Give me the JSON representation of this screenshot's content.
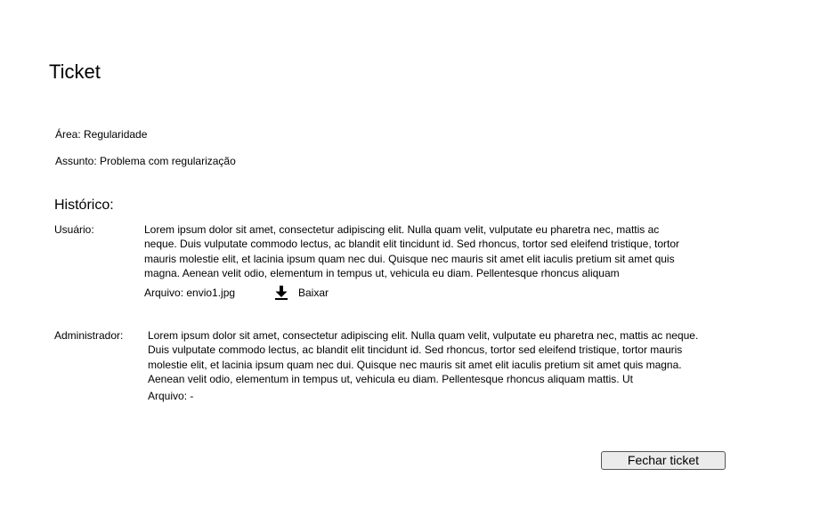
{
  "page": {
    "title": "Ticket"
  },
  "ticket": {
    "area": "Área: Regularidade",
    "subject": "Assunto: Problema com regularização"
  },
  "history": {
    "title": "Histórico:",
    "entries": [
      {
        "author": "Usuário:",
        "message": "Lorem ipsum dolor sit amet, consectetur adipiscing elit. Nulla quam velit, vulputate eu pharetra nec, mattis ac neque. Duis vulputate commodo lectus, ac blandit elit tincidunt id. Sed rhoncus, tortor sed eleifend tristique, tortor mauris molestie elit, et lacinia ipsum quam nec dui. Quisque nec mauris sit amet elit iaculis pretium sit amet quis magna. Aenean velit odio, elementum in tempus ut, vehicula eu diam. Pellentesque rhoncus aliquam",
        "attachment": "Arquivo: envio1.jpg",
        "download_label": "Baixar",
        "download_icon": "download-icon"
      },
      {
        "author": "Administrador:",
        "message": "Lorem ipsum dolor sit amet, consectetur adipiscing elit. Nulla quam velit, vulputate eu pharetra nec, mattis ac neque. Duis vulputate commodo lectus, ac blandit elit tincidunt id. Sed rhoncus, tortor sed eleifend tristique, tortor mauris molestie elit, et lacinia ipsum quam nec dui. Quisque nec mauris sit amet elit iaculis pretium sit amet quis magna. Aenean velit odio, elementum in tempus ut, vehicula eu diam. Pellentesque rhoncus aliquam mattis. Ut",
        "attachment": "Arquivo: -"
      }
    ]
  },
  "actions": {
    "close_label": "Fechar ticket"
  },
  "colors": {
    "background": "#ffffff",
    "text": "#000000",
    "button_background": "#ebebeb",
    "button_border": "#555555"
  }
}
